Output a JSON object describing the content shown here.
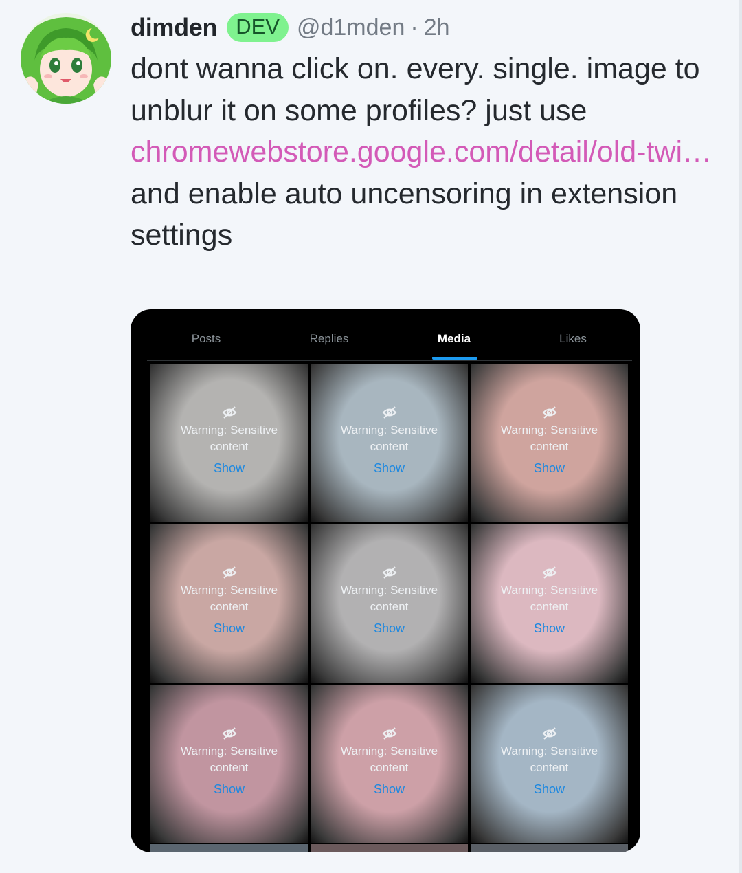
{
  "tweet": {
    "display_name": "dimden",
    "badge": "DEV",
    "handle": "@d1mden",
    "separator": "·",
    "time": "2h",
    "text_before": "dont wanna click on. every. single. image to unblur it on some profiles? just use ",
    "link_text": "chromewebstore.google.com/detail/old-twi…",
    "text_after": " and enable auto uncensoring in extension settings"
  },
  "media": {
    "tabs": [
      {
        "label": "Posts",
        "active": false
      },
      {
        "label": "Replies",
        "active": false
      },
      {
        "label": "Media",
        "active": true
      },
      {
        "label": "Likes",
        "active": false
      }
    ],
    "tiles": [
      {
        "warning": "Warning: Sensitive content",
        "action": "Show",
        "tint": "#b4b3b1"
      },
      {
        "warning": "Warning: Sensitive content",
        "action": "Show",
        "tint": "#a8b6bf"
      },
      {
        "warning": "Warning: Sensitive content",
        "action": "Show",
        "tint": "#cfa49e"
      },
      {
        "warning": "Warning: Sensitive content",
        "action": "Show",
        "tint": "#c9a7a3"
      },
      {
        "warning": "Warning: Sensitive content",
        "action": "Show",
        "tint": "#b2b1b2"
      },
      {
        "warning": "Warning: Sensitive content",
        "action": "Show",
        "tint": "#dcb8c0"
      },
      {
        "warning": "Warning: Sensitive content",
        "action": "Show",
        "tint": "#c195a0"
      },
      {
        "warning": "Warning: Sensitive content",
        "action": "Show",
        "tint": "#cda0a7"
      },
      {
        "warning": "Warning: Sensitive content",
        "action": "Show",
        "tint": "#a4b6c5"
      }
    ],
    "link_color": "#d35ab7",
    "accent_color": "#1d9bf0"
  }
}
